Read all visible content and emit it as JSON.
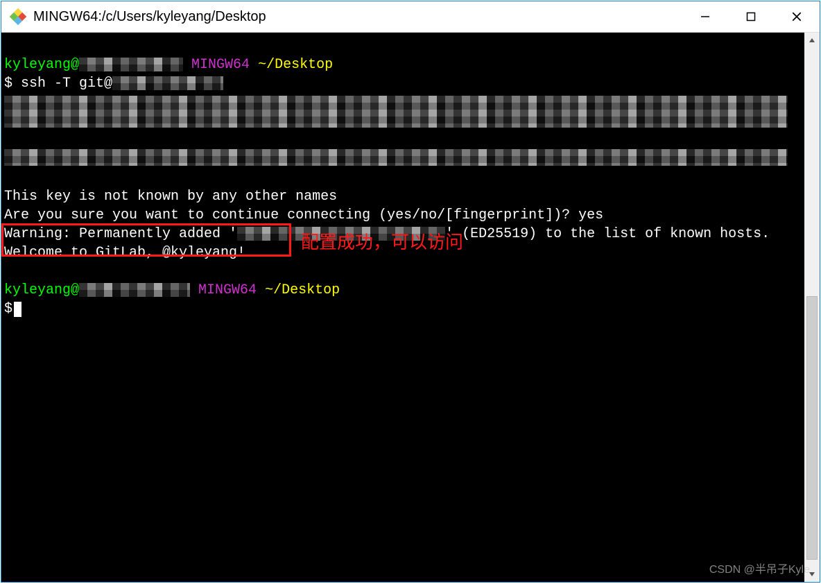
{
  "window": {
    "title": "MINGW64:/c/Users/kyleyang/Desktop"
  },
  "terminal": {
    "prompt1_user": "kyleyang",
    "prompt1_env": "MINGW64",
    "prompt1_path": "~/Desktop",
    "cmd1_symbol": "$ ",
    "cmd1_text": "ssh -T git@",
    "line_unknown_key": "This key is not known by any other names",
    "line_confirm": "Are you sure you want to continue connecting (yes/no/[fingerprint])? yes",
    "line_warn_a": "Warning: Permanently added '",
    "line_warn_b": "' (ED25519) to the list of known hosts.",
    "line_welcome": "Welcome to GitLab, @kyleyang!",
    "prompt2_user": "kyleyang",
    "prompt2_env": "MINGW64",
    "prompt2_path": "~/Desktop",
    "cmd2_symbol": "$"
  },
  "annotation": {
    "text": "配置成功，可以访问"
  },
  "watermark": {
    "text": "CSDN @半吊子Kyle"
  }
}
